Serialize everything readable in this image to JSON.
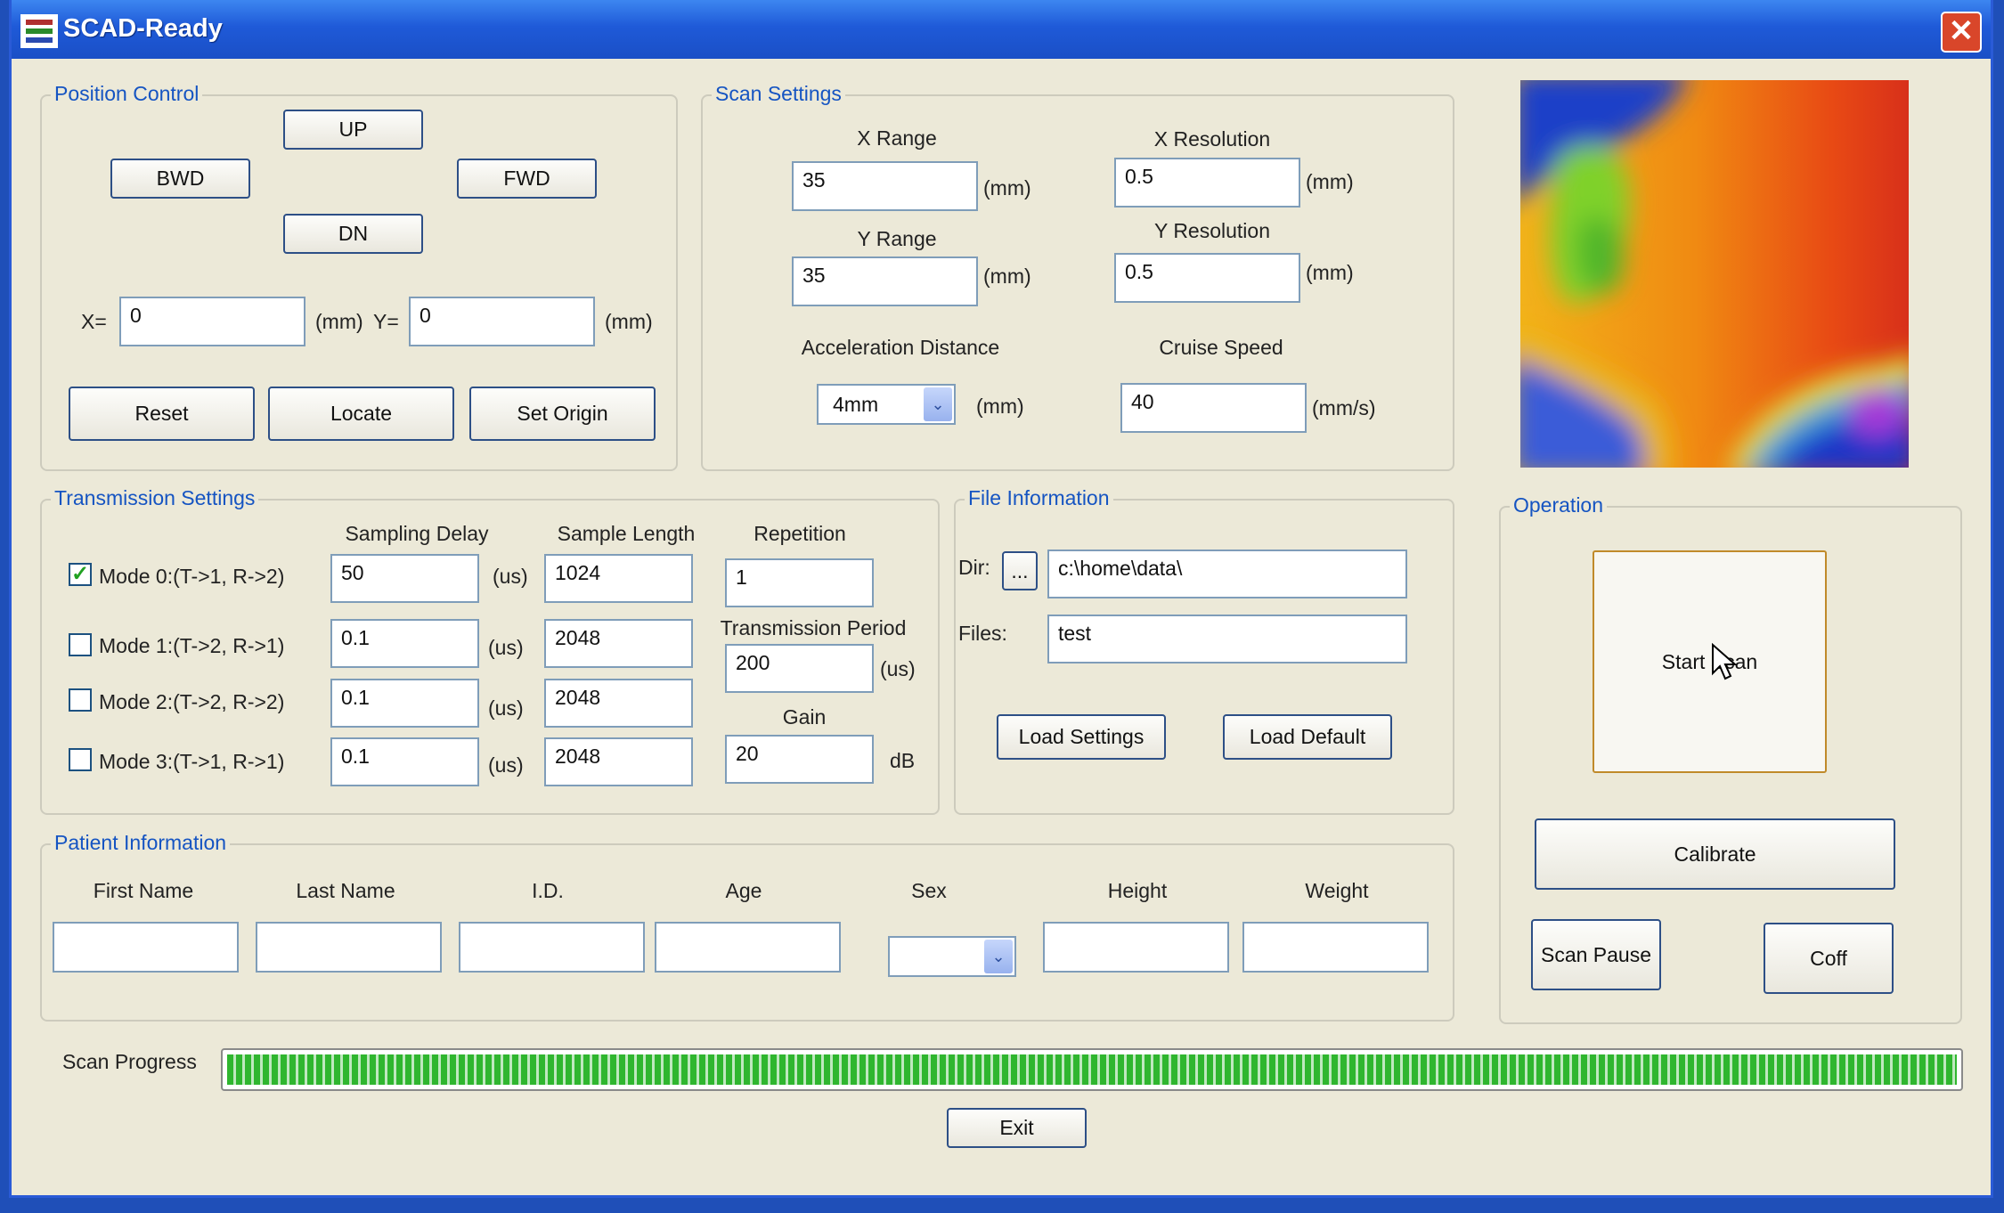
{
  "window": {
    "title": "SCAD-Ready",
    "close_glyph": "✕"
  },
  "position_control": {
    "title": "Position Control",
    "up": "UP",
    "bwd": "BWD",
    "fwd": "FWD",
    "dn": "DN",
    "x_label": "X=",
    "x_value": "0",
    "x_unit": "(mm)",
    "y_label": "Y=",
    "y_value": "0",
    "y_unit": "(mm)",
    "reset": "Reset",
    "locate": "Locate",
    "set_origin": "Set Origin"
  },
  "scan_settings": {
    "title": "Scan Settings",
    "x_range_label": "X Range",
    "x_range": "35",
    "x_range_unit": "(mm)",
    "y_range_label": "Y Range",
    "y_range": "35",
    "y_range_unit": "(mm)",
    "x_res_label": "X Resolution",
    "x_res": "0.5",
    "x_res_unit": "(mm)",
    "y_res_label": "Y Resolution",
    "y_res": "0.5",
    "y_res_unit": "(mm)",
    "accel_label": "Acceleration Distance",
    "accel_value": "4mm",
    "accel_unit": "(mm)",
    "cruise_label": "Cruise Speed",
    "cruise_value": "40",
    "cruise_unit": "(mm/s)"
  },
  "transmission": {
    "title": "Transmission Settings",
    "col_delay": "Sampling Delay",
    "col_length": "Sample Length",
    "col_repetition": "Repetition",
    "repetition": "1",
    "period_label": "Transmission Period",
    "period": "200",
    "period_unit": "(us)",
    "gain_label": "Gain",
    "gain": "20",
    "gain_unit": "dB",
    "modes": [
      {
        "label": "Mode 0:(T->1, R->2)",
        "checked": true,
        "check_glyph": "✓",
        "delay": "50",
        "unit": "(us)",
        "length": "1024"
      },
      {
        "label": "Mode 1:(T->2, R->1)",
        "checked": false,
        "check_glyph": "",
        "delay": "0.1",
        "unit": "(us)",
        "length": "2048"
      },
      {
        "label": "Mode 2:(T->2, R->2)",
        "checked": false,
        "check_glyph": "",
        "delay": "0.1",
        "unit": "(us)",
        "length": "2048"
      },
      {
        "label": "Mode 3:(T->1, R->1)",
        "checked": false,
        "check_glyph": "",
        "delay": "0.1",
        "unit": "(us)",
        "length": "2048"
      }
    ]
  },
  "file_info": {
    "title": "File Information",
    "dir_label": "Dir:",
    "browse": "...",
    "dir_value": "c:\\home\\data\\",
    "files_label": "Files:",
    "files_value": "test",
    "load_settings": "Load Settings",
    "load_default": "Load Default"
  },
  "patient": {
    "title": "Patient Information",
    "first_name": "First Name",
    "last_name": "Last Name",
    "id": "I.D.",
    "age": "Age",
    "sex": "Sex",
    "height": "Height",
    "weight": "Weight"
  },
  "operation": {
    "title": "Operation",
    "start_scan": "Start Scan",
    "calibrate": "Calibrate",
    "scan_pause": "Scan Pause",
    "coff": "Coff"
  },
  "progress": {
    "label": "Scan Progress",
    "value": 1.0
  },
  "exit": "Exit",
  "icons": {
    "dropdown": "⌄"
  },
  "colors": {
    "title_bar": "#2458d6",
    "group_title": "#1554c2",
    "progress": "#2fb62f",
    "close": "#d9462a"
  }
}
